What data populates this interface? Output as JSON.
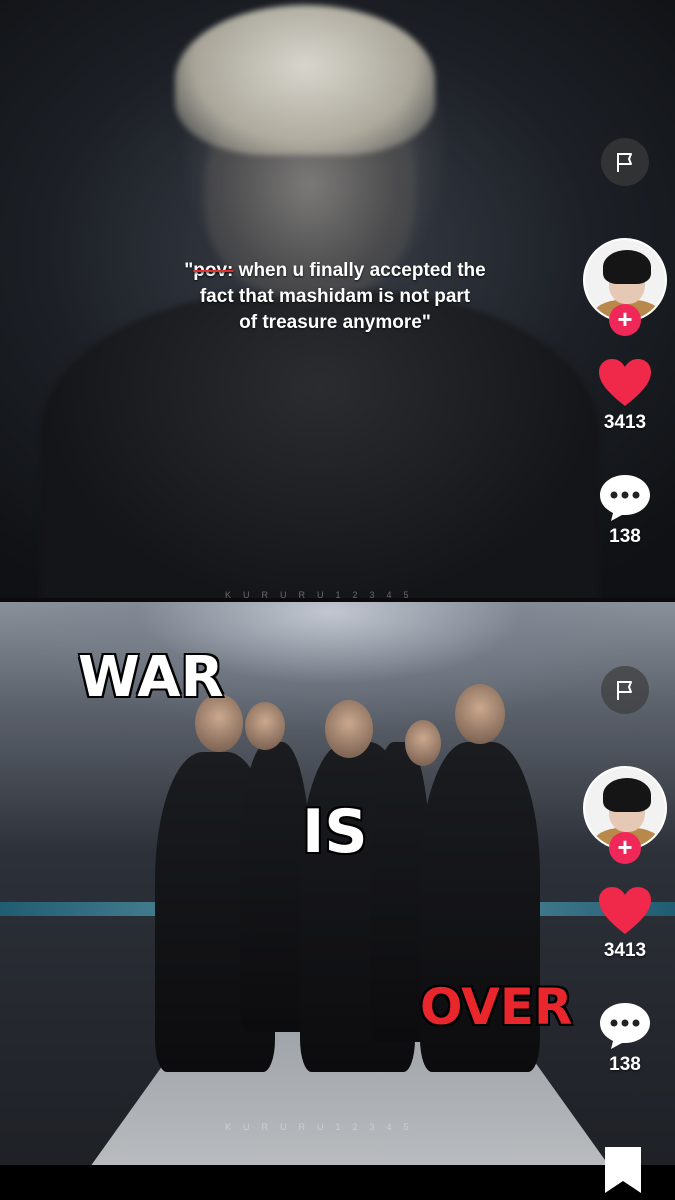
{
  "top_video": {
    "caption_strike": "pov:",
    "caption_open_quote": "\"",
    "caption_line1_rest": " when u finally accepted the",
    "caption_line2": "fact that mashidam is not part",
    "caption_line3": "of treasure anymore\"",
    "watermark": "KURURU12345",
    "rail": {
      "flag_icon": "flag-icon",
      "like_count": "3413",
      "comment_count": "138"
    }
  },
  "bottom_video": {
    "meme_words": [
      "WAR",
      "IS",
      "OVER"
    ],
    "meme_colors": {
      "war": "#ffffff",
      "is": "#ffffff",
      "over": "#e8262b"
    },
    "watermark": "KURURU12345",
    "rail": {
      "flag_icon": "flag-icon",
      "like_count": "3413",
      "comment_count": "138",
      "bookmark_icon": "bookmark-icon"
    }
  },
  "colors": {
    "like_heart": "#f0284a",
    "follow_plus": "#f0285a",
    "meme_over": "#e8262b"
  }
}
